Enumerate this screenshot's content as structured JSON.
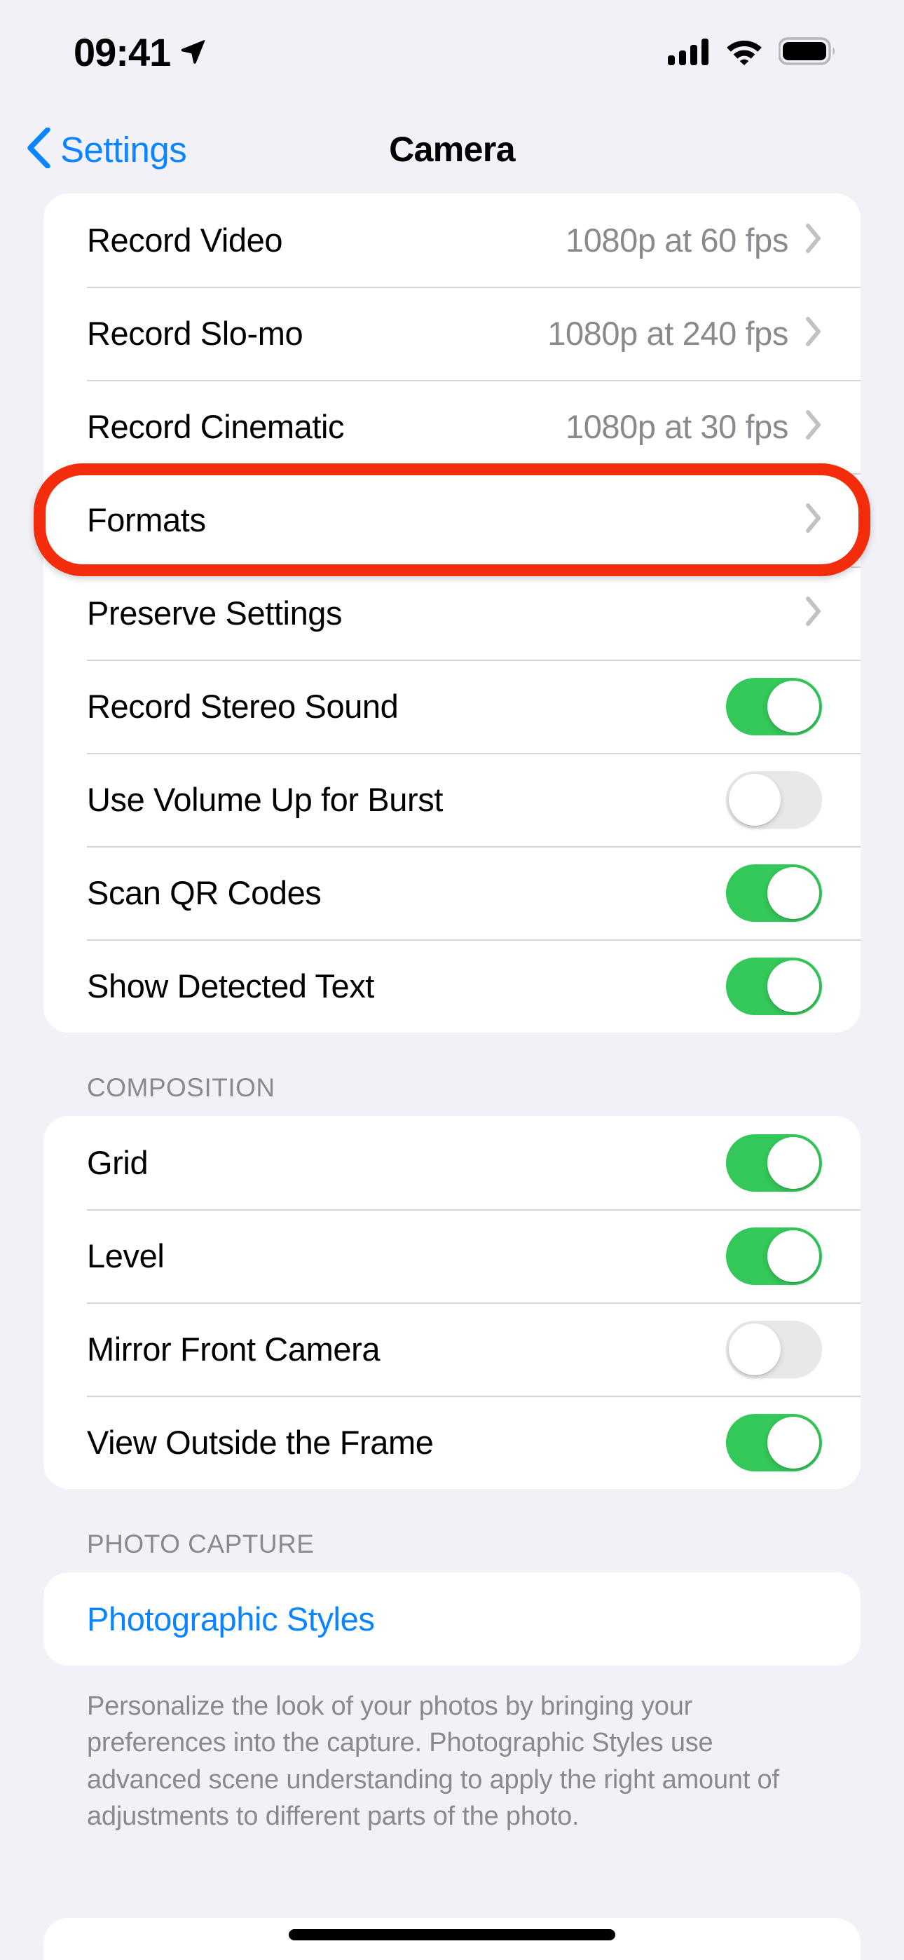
{
  "status_bar": {
    "time": "09:41",
    "location_icon": "location-arrow-icon",
    "cellular_icon": "cellular-signal-icon",
    "wifi_icon": "wifi-icon",
    "battery_icon": "battery-full-icon"
  },
  "nav": {
    "back_label": "Settings",
    "back_icon": "chevron-left-icon",
    "title": "Camera"
  },
  "groups": [
    {
      "rows": [
        {
          "label": "Record Video",
          "value": "1080p at 60 fps",
          "type": "disclosure"
        },
        {
          "label": "Record Slo-mo",
          "value": "1080p at 240 fps",
          "type": "disclosure"
        },
        {
          "label": "Record Cinematic",
          "value": "1080p at 30 fps",
          "type": "disclosure"
        },
        {
          "label": "Formats",
          "value": "",
          "type": "disclosure",
          "highlighted": true
        },
        {
          "label": "Preserve Settings",
          "value": "",
          "type": "disclosure"
        },
        {
          "label": "Record Stereo Sound",
          "toggle": "on",
          "type": "toggle"
        },
        {
          "label": "Use Volume Up for Burst",
          "toggle": "off",
          "type": "toggle"
        },
        {
          "label": "Scan QR Codes",
          "toggle": "on",
          "type": "toggle"
        },
        {
          "label": "Show Detected Text",
          "toggle": "on",
          "type": "toggle"
        }
      ]
    },
    {
      "header": "COMPOSITION",
      "rows": [
        {
          "label": "Grid",
          "toggle": "on",
          "type": "toggle"
        },
        {
          "label": "Level",
          "toggle": "on",
          "type": "toggle"
        },
        {
          "label": "Mirror Front Camera",
          "toggle": "off",
          "type": "toggle"
        },
        {
          "label": "View Outside the Frame",
          "toggle": "on",
          "type": "toggle"
        }
      ]
    },
    {
      "header": "PHOTO CAPTURE",
      "rows": [
        {
          "label": "Photographic Styles",
          "type": "link"
        }
      ],
      "footer": "Personalize the look of your photos by bringing your preferences into the capture. Photographic Styles use advanced scene understanding to apply the right amount of adjustments to different parts of the photo."
    }
  ],
  "colors": {
    "accent_blue": "#0A84FF",
    "toggle_on_green": "#34C759",
    "toggle_off_gray": "#E8E8EA",
    "highlight_red": "#F32D0C",
    "page_background": "#F2F1F7",
    "card_background": "#FFFFFF",
    "secondary_text": "#8A8A8E"
  }
}
